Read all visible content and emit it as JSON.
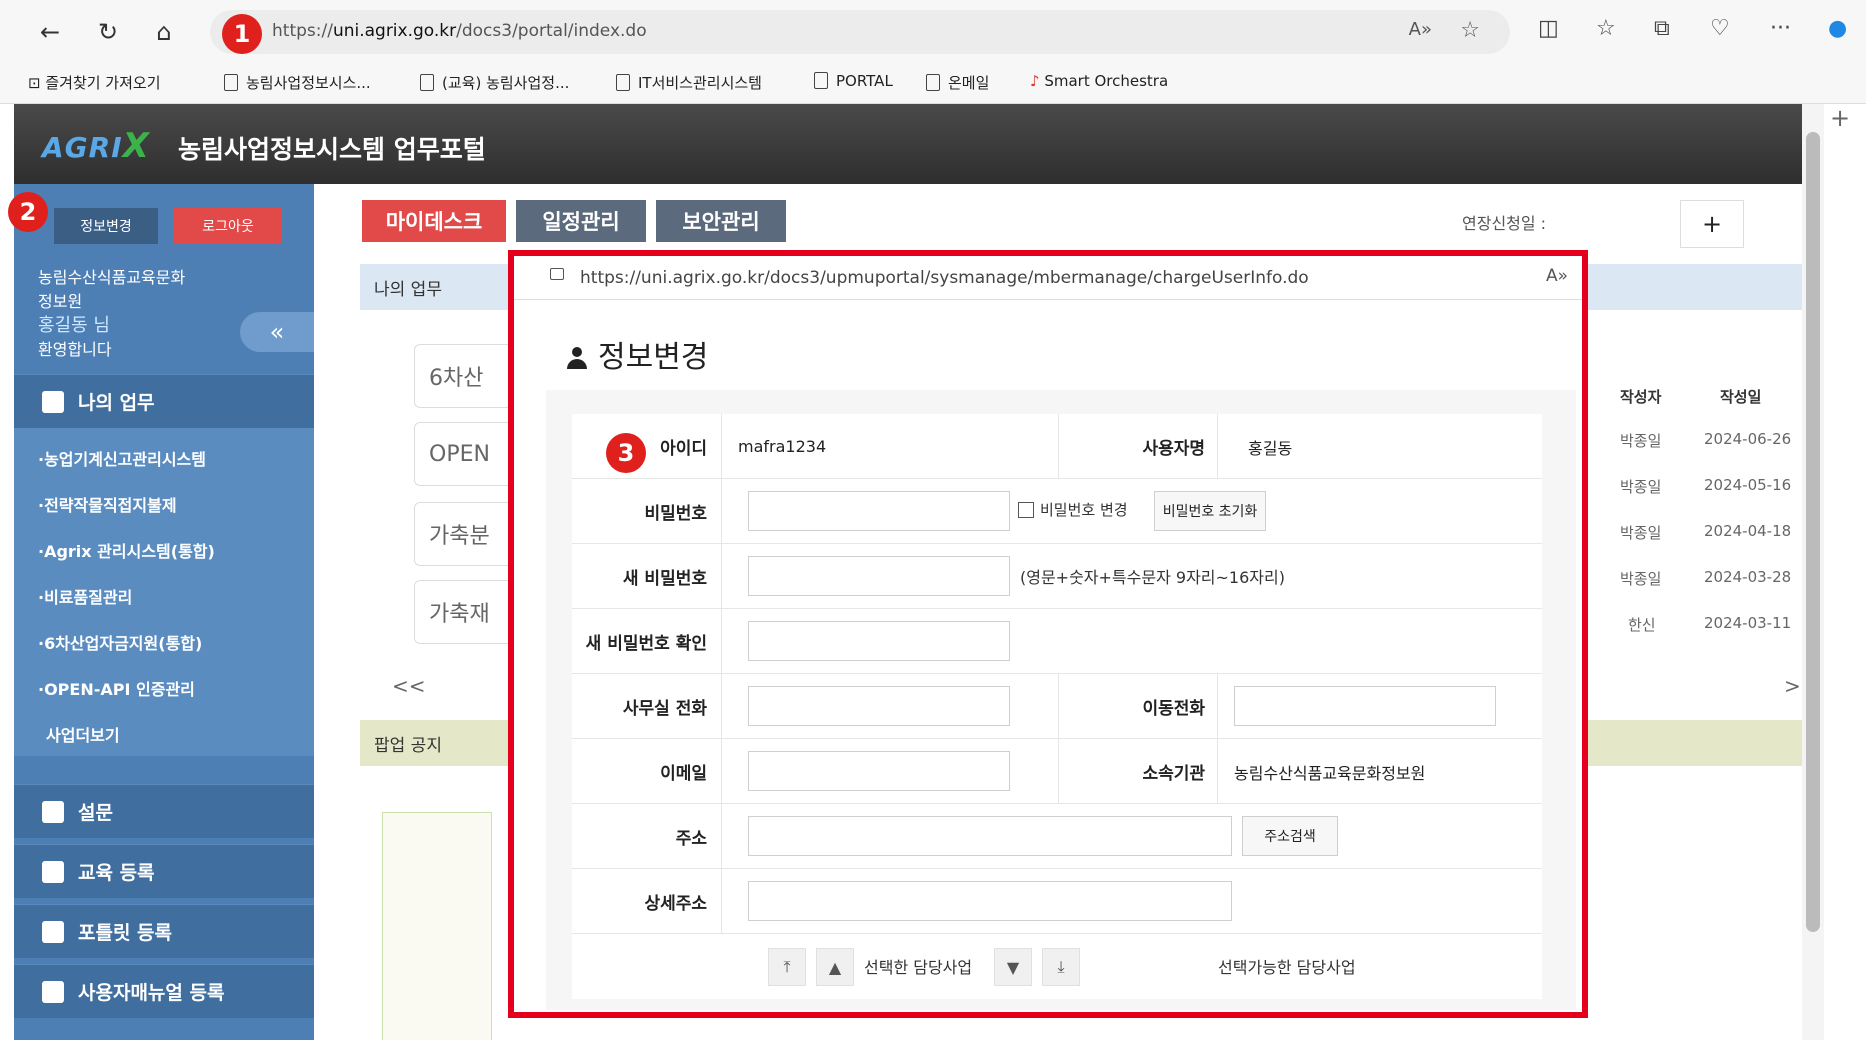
{
  "browser": {
    "url_host_prefix": "https://",
    "url_host": "uni.agrix.go.kr",
    "url_path": "/docs3/portal/index.do",
    "favorites": [
      {
        "label": "즐겨찾기 가져오기"
      },
      {
        "label": "농림사업정보시스..."
      },
      {
        "label": "(교육) 농림사업정..."
      },
      {
        "label": "IT서비스관리시스템"
      },
      {
        "label": "PORTAL"
      },
      {
        "label": "온메일"
      },
      {
        "label": "Smart Orchestra"
      }
    ]
  },
  "badges": [
    "1",
    "2",
    "3"
  ],
  "portal": {
    "logo_text": "AGRI",
    "logo_x": "X",
    "title": "농림사업정보시스템 업무포털"
  },
  "sidebar": {
    "info_change": "정보변경",
    "logout": "로그아웃",
    "org_line1": "농림수산식품교육문화",
    "org_line2": "정보원",
    "user_name": "홍길동 님",
    "welcome": "환영합니다",
    "collapse": "«",
    "my_work": "나의 업무",
    "links": [
      "·농업기계신고관리시스템",
      "·전략작물직접지불제",
      "·Agrix 관리시스템(통합)",
      "·비료품질관리",
      "·6차산업자금지원(통합)",
      "·OPEN-API 인증관리",
      "사업더보기"
    ],
    "sections": [
      "설문",
      "교육 등록",
      "포틀릿 등록",
      "사용자매뉴얼 등록"
    ]
  },
  "main": {
    "tabs": [
      "마이데스크",
      "일정관리",
      "보안관리"
    ],
    "extension_label": "연장신청일 :",
    "plus": "+",
    "my_work_title": "나의 업무",
    "work_cards": [
      "6차산",
      "OPEN",
      "가축분",
      "가축재"
    ],
    "prev": "<<",
    "next": ">",
    "popup_notice_title": "팝업 공지",
    "table_headers": [
      "작성자",
      "작성일"
    ],
    "table_rows": [
      [
        "박종일",
        "2024-06-26"
      ],
      [
        "박종일",
        "2024-05-16"
      ],
      [
        "박종일",
        "2024-04-18"
      ],
      [
        "박종일",
        "2024-03-28"
      ],
      [
        "한신",
        "2024-03-11"
      ]
    ]
  },
  "popup": {
    "url": "https://uni.agrix.go.kr/docs3/upmuportal/sysmanage/mbermanage/chargeUserInfo.do",
    "title": "정보변경",
    "id_label": "아이디",
    "id_value": "mafra1234",
    "username_label": "사용자명",
    "username_value": "홍길동",
    "password_label": "비밀번호",
    "password_change_label": "비밀번호 변경",
    "password_reset_button": "비밀번호 초기화",
    "new_password_label": "새 비밀번호",
    "new_password_hint": "(영문+숫자+특수문자 9자리~16자리)",
    "confirm_password_label": "새 비밀번호 확인",
    "office_phone_label": "사무실 전화",
    "mobile_label": "이동전화",
    "email_label": "이메일",
    "org_label": "소속기관",
    "org_value": "농림수산식품교육문화정보원",
    "address_label": "주소",
    "address_search_button": "주소검색",
    "detail_address_label": "상세주소",
    "selected_business_label": "선택한 담당사업",
    "available_business_label": "선택가능한 담당사업"
  },
  "colors": {
    "accent_red": "#e4001c",
    "sidebar_blue": "#4e7fb4",
    "tab_red": "#e24a4a",
    "tab_gray": "#5b6a7c"
  }
}
